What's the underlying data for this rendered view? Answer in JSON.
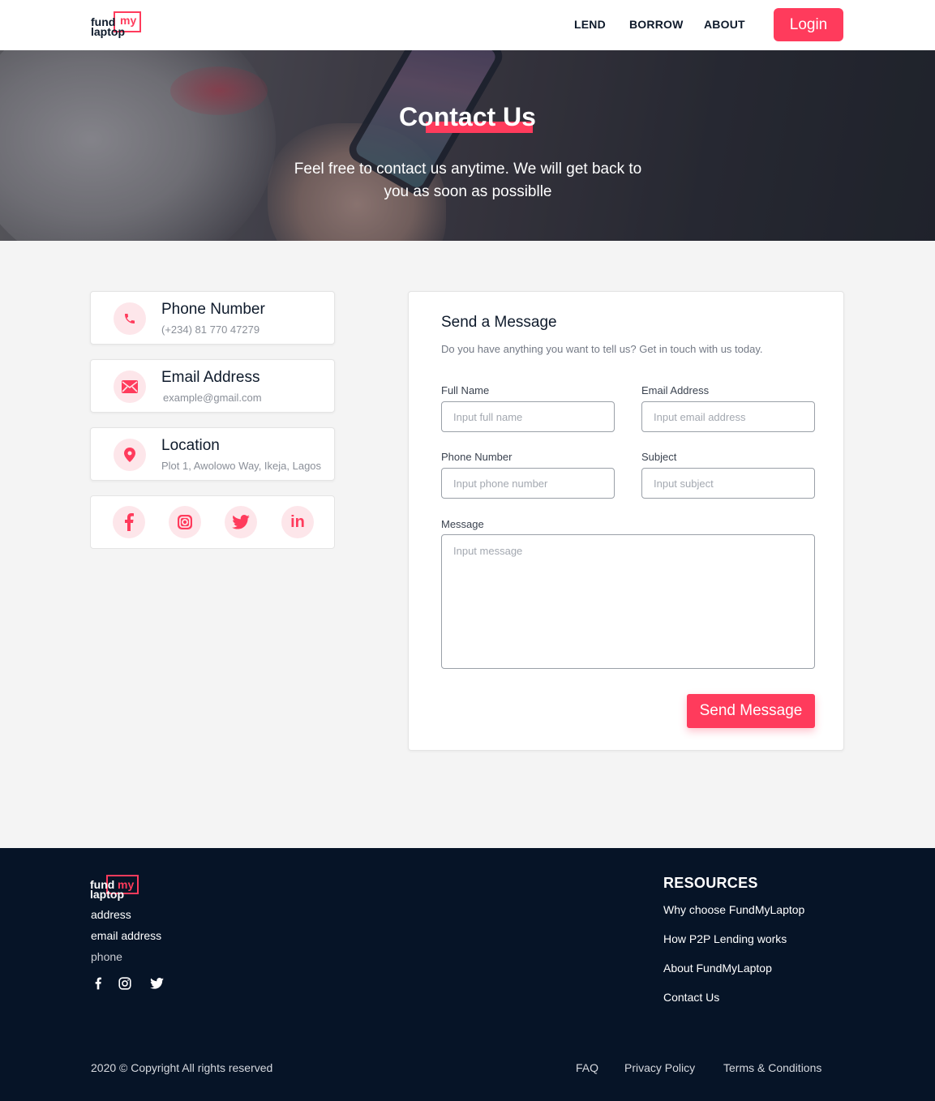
{
  "brand": {
    "line1": "fund",
    "line2": "laptop",
    "accent_word": "my",
    "accent_color": "#ff3b5c"
  },
  "nav": {
    "links": [
      "LEND",
      "BORROW",
      "ABOUT"
    ],
    "login_label": "Login"
  },
  "hero": {
    "title": "Contact Us",
    "subtitle": "Feel free to contact us anytime. We will get back to you as soon as possiblle"
  },
  "contact_cards": {
    "phone": {
      "title": "Phone Number",
      "value": "(+234) 81 770 47279",
      "icon": "phone-icon"
    },
    "email": {
      "title": "Email Address",
      "value": "example@gmail.com",
      "icon": "mail-icon"
    },
    "location": {
      "title": "Location",
      "value": "Plot 1, Awolowo Way, Ikeja, Lagos",
      "icon": "map-pin-icon"
    },
    "socials": [
      "facebook-icon",
      "instagram-icon",
      "twitter-icon",
      "linkedin-icon"
    ]
  },
  "form": {
    "title": "Send a Message",
    "description": "Do you have anything you want to tell us? Get in touch with us today.",
    "full_name": {
      "label": "Full Name",
      "placeholder": "Input full name"
    },
    "email": {
      "label": "Email Address",
      "placeholder": "Input email address"
    },
    "phone": {
      "label": "Phone Number",
      "placeholder": "Input phone number"
    },
    "subject": {
      "label": "Subject",
      "placeholder": "Input subject"
    },
    "message": {
      "label": "Message",
      "placeholder": "Input message"
    },
    "submit_label": "Send Message"
  },
  "footer": {
    "address": "address",
    "email": "email address",
    "phone": "phone",
    "socials": [
      "facebook-icon",
      "instagram-icon",
      "twitter-icon"
    ],
    "resources_title": "RESOURCES",
    "resources": [
      "Why choose FundMyLaptop",
      "How P2P Lending works",
      "About FundMyLaptop",
      "Contact Us"
    ],
    "copyright": "2020 © Copyright All rights reserved",
    "bottom_links": [
      "FAQ",
      "Privacy Policy",
      "Terms & Conditions"
    ]
  },
  "colors": {
    "accent": "#ff3b5c",
    "footer_bg": "#061427",
    "page_bg": "#f4f4f4"
  }
}
